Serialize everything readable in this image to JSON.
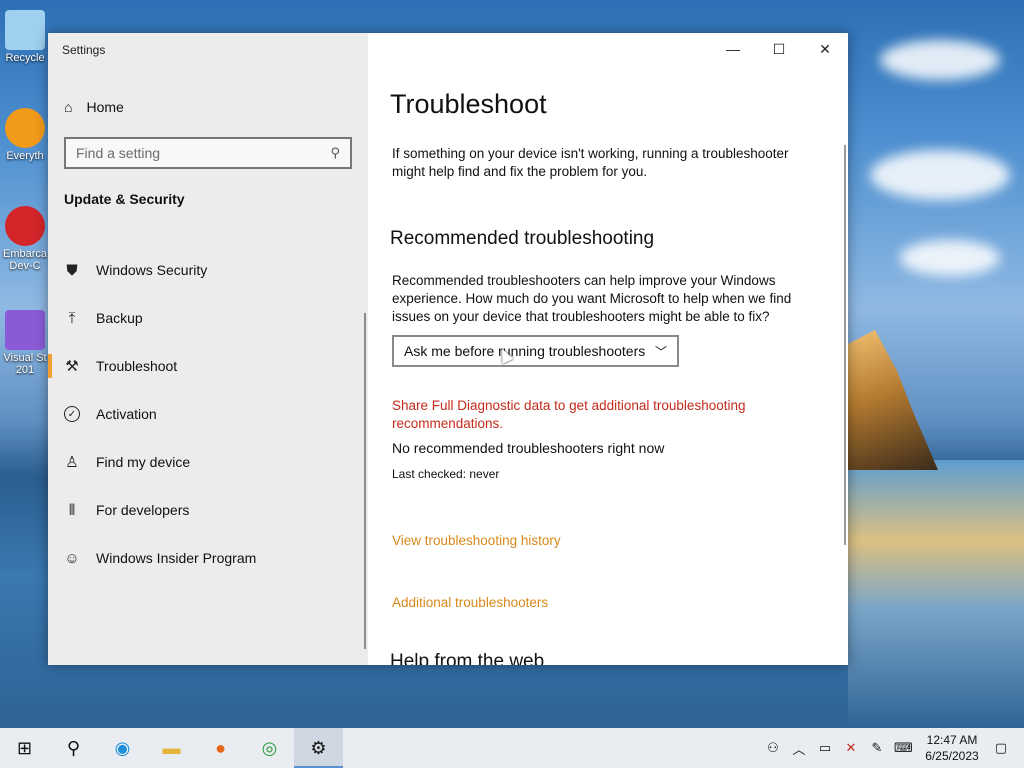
{
  "desktop": {
    "icons": [
      {
        "label": "Recycle",
        "color": "#9fd0f0"
      },
      {
        "label": "Everyth",
        "color": "#f29a1a"
      },
      {
        "label": "Embarca Dev-C",
        "color": "#d3252a"
      },
      {
        "label": "Visual St 201",
        "color": "#8a5bd6"
      }
    ]
  },
  "window": {
    "title": "Settings",
    "controls": {
      "minimize": "—",
      "maximize": "☐",
      "close": "✕"
    }
  },
  "sidebar": {
    "home_label": "Home",
    "search_placeholder": "Find a setting",
    "section_title": "Update & Security",
    "items": [
      {
        "label": "Windows Security",
        "icon": "shield-icon",
        "glyph": "⛊"
      },
      {
        "label": "Backup",
        "icon": "backup-arrow-icon",
        "glyph": "⤒"
      },
      {
        "label": "Troubleshoot",
        "icon": "wrench-icon",
        "glyph": "🔧",
        "selected": true
      },
      {
        "label": "Activation",
        "icon": "check-circle-icon",
        "glyph": "✓"
      },
      {
        "label": "Find my device",
        "icon": "person-location-icon",
        "glyph": "⚲"
      },
      {
        "label": "For developers",
        "icon": "developer-tools-icon",
        "glyph": "⚙"
      },
      {
        "label": "Windows Insider Program",
        "icon": "insider-cat-icon",
        "glyph": "☺"
      }
    ]
  },
  "main": {
    "title": "Troubleshoot",
    "intro": "If something on your device isn't working, running a troubleshooter might help find and fix the problem for you.",
    "recommended_heading": "Recommended troubleshooting",
    "recommended_text": "Recommended troubleshooters can help improve your Windows experience. How much do you want Microsoft to help when we find issues on your device that troubleshooters might be able to fix?",
    "dropdown_value": "Ask me before running troubleshooters",
    "diagnostic_link": "Share Full Diagnostic data to get additional troubleshooting recommendations.",
    "none_text": "No recommended troubleshooters right now",
    "last_checked": "Last checked: never",
    "history_link": "View troubleshooting history",
    "additional_link": "Additional troubleshooters",
    "web_heading": "Help from the web"
  },
  "taskbar": {
    "apps": [
      {
        "name": "start-button",
        "glyph": "⊞"
      },
      {
        "name": "search-button",
        "glyph": "⚲"
      },
      {
        "name": "edge-button",
        "glyph": "◉"
      },
      {
        "name": "file-explorer-button",
        "glyph": "▭"
      },
      {
        "name": "firefox-button",
        "glyph": "◍"
      },
      {
        "name": "chrome-button",
        "glyph": "◎"
      },
      {
        "name": "settings-button",
        "glyph": "⚙",
        "active": true
      }
    ],
    "tray": {
      "time": "12:47 AM",
      "date": "6/25/2023"
    }
  },
  "colors": {
    "accent": "#f0a030",
    "diagnostic_link": "#c42b1c",
    "links": "#d9891a"
  }
}
